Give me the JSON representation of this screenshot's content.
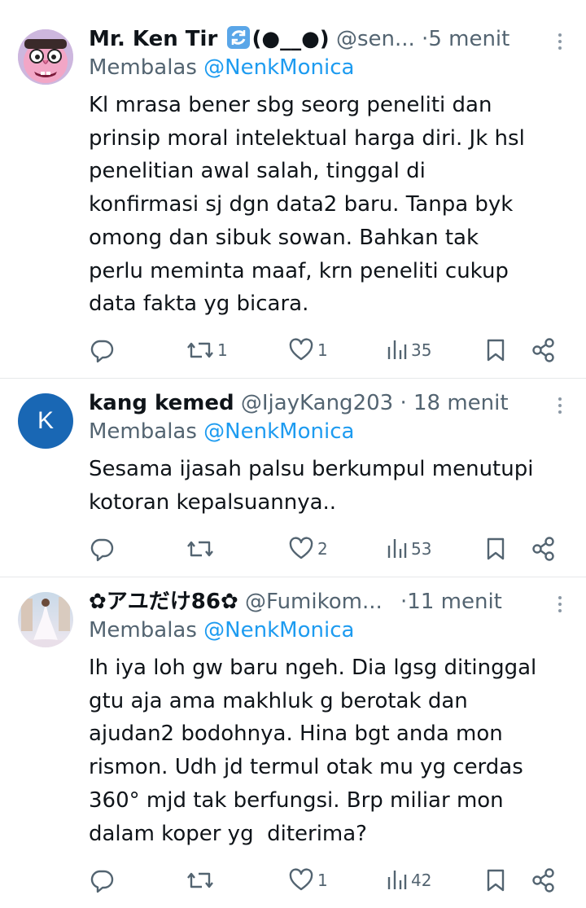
{
  "tweets": [
    {
      "name": "Mr. Ken Tir",
      "name_suffix": "(●__●)",
      "handle": "@sen...",
      "separator": "·",
      "time": "5 menit",
      "reply_prefix": "Membalas",
      "reply_mention": "@NenkMonica",
      "text": "Kl mrasa bener sbg seorg peneliti dan\nprinsip moral intelektual harga diri. Jk hsl\npenelitian awal salah, tinggal di\nkonfirmasi sj dgn data2 baru. Tanpa byk\nomong dan sibuk sowan. Bahkan tak\nperlu meminta maaf, krn peneliti cukup\ndata fakta yg bicara.",
      "replies": "",
      "retweets": "1",
      "likes": "1",
      "views": "35",
      "avatar_icon": "cartoon-face-avatar"
    },
    {
      "name": "kang kemed",
      "handle": "@IjayKang203",
      "separator": "·",
      "time": "18 menit",
      "reply_prefix": "Membalas",
      "reply_mention": "@NenkMonica",
      "text": "Sesama ijasah palsu berkumpul menutupi\nkotoran kepalsuannya..",
      "avatar_letter": "K",
      "replies": "",
      "retweets": "",
      "likes": "2",
      "views": "53"
    },
    {
      "name": "✿アユだけ86✿",
      "handle": "@Fumikom...",
      "separator": "·",
      "time": "11 menit",
      "reply_prefix": "Membalas",
      "reply_mention": "@NenkMonica",
      "text": "Ih iya loh gw baru ngeh. Dia lgsg ditinggal\ngtu aja ama makhluk g berotak dan\najudan2 bodohnya. Hina bgt anda mon\nrismon. Udh jd termul otak mu yg cerdas\n360° mjd tak berfungsi. Brp miliar mon\ndalam koper yg  diterima?",
      "replies": "",
      "retweets": "",
      "likes": "1",
      "views": "42",
      "avatar_icon": "photo-avatar"
    }
  ],
  "colors": {
    "text": "#0f1419",
    "secondary": "#536471",
    "link": "#1d9bf0",
    "divider": "#e6e8ea",
    "k_avatar": "#1967b4"
  }
}
